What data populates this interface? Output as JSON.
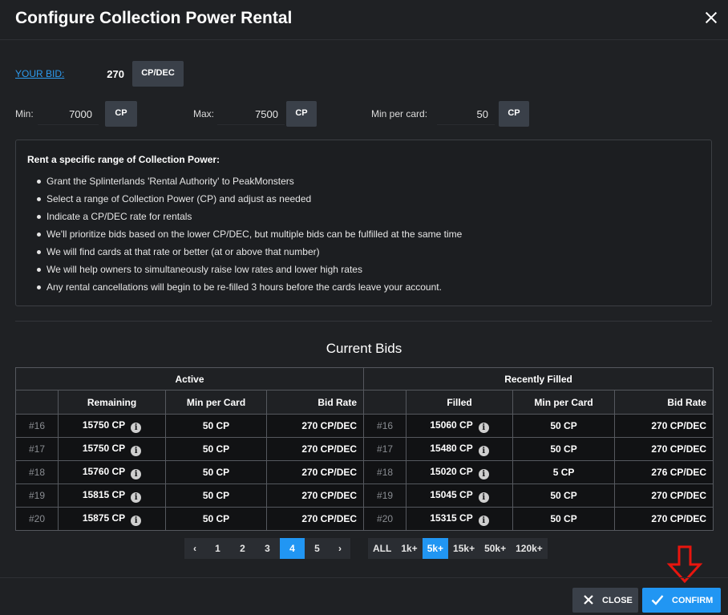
{
  "dialog": {
    "title": "Configure Collection Power Rental"
  },
  "bid": {
    "label": "YOUR BID:",
    "value": "270",
    "unit": "CP/DEC"
  },
  "range": {
    "min_label": "Min:",
    "min_value": "7000",
    "min_unit": "CP",
    "max_label": "Max:",
    "max_value": "7500",
    "max_unit": "CP",
    "per_card_label": "Min per card:",
    "per_card_value": "50",
    "per_card_unit": "CP"
  },
  "info": {
    "title": "Rent a specific range of Collection Power:",
    "items": [
      "Grant the Splinterlands 'Rental Authority' to PeakMonsters",
      "Select a range of Collection Power (CP) and adjust as needed",
      "Indicate a CP/DEC rate for rentals",
      "We'll prioritize bids based on the lower CP/DEC, but multiple bids can be fulfilled at the same time",
      "We will find cards at that rate or better (at or above that number)",
      "We will help owners to simultaneously raise low rates and lower high rates",
      "Any rental cancellations will begin to be re-filled 3 hours before the cards leave your account."
    ]
  },
  "bids": {
    "title": "Current Bids",
    "active_header": "Active",
    "filled_header": "Recently Filled",
    "active_columns": [
      "Remaining",
      "Min per Card",
      "Bid Rate"
    ],
    "filled_columns": [
      "Filled",
      "Min per Card",
      "Bid Rate"
    ],
    "rows": [
      {
        "a_idx": "#16",
        "a_remaining": "15750 CP",
        "a_min": "50 CP",
        "a_rate": "270 CP/DEC",
        "f_idx": "#16",
        "f_filled": "15060 CP",
        "f_min": "50 CP",
        "f_rate": "270 CP/DEC"
      },
      {
        "a_idx": "#17",
        "a_remaining": "15750 CP",
        "a_min": "50 CP",
        "a_rate": "270 CP/DEC",
        "f_idx": "#17",
        "f_filled": "15480 CP",
        "f_min": "50 CP",
        "f_rate": "270 CP/DEC"
      },
      {
        "a_idx": "#18",
        "a_remaining": "15760 CP",
        "a_min": "50 CP",
        "a_rate": "270 CP/DEC",
        "f_idx": "#18",
        "f_filled": "15020 CP",
        "f_min": "5 CP",
        "f_rate": "276 CP/DEC"
      },
      {
        "a_idx": "#19",
        "a_remaining": "15815 CP",
        "a_min": "50 CP",
        "a_rate": "270 CP/DEC",
        "f_idx": "#19",
        "f_filled": "15045 CP",
        "f_min": "50 CP",
        "f_rate": "270 CP/DEC"
      },
      {
        "a_idx": "#20",
        "a_remaining": "15875 CP",
        "a_min": "50 CP",
        "a_rate": "270 CP/DEC",
        "f_idx": "#20",
        "f_filled": "15315 CP",
        "f_min": "50 CP",
        "f_rate": "270 CP/DEC"
      }
    ],
    "info_icon": "i"
  },
  "pagination": {
    "prev": "‹",
    "next": "›",
    "pages": [
      "1",
      "2",
      "3",
      "4",
      "5"
    ],
    "active_page": "4"
  },
  "filters": {
    "items": [
      "ALL",
      "1k+",
      "5k+",
      "15k+",
      "50k+",
      "120k+"
    ],
    "active": "5k+"
  },
  "footer": {
    "close_label": "CLOSE",
    "confirm_label": "CONFIRM"
  },
  "colors": {
    "accent": "#2196f3",
    "annotation_arrow": "#e8150e"
  },
  "icons": {
    "close": "close-icon",
    "confirm": "check-icon",
    "annotation": "arrow-down-icon",
    "info": "info-icon"
  }
}
